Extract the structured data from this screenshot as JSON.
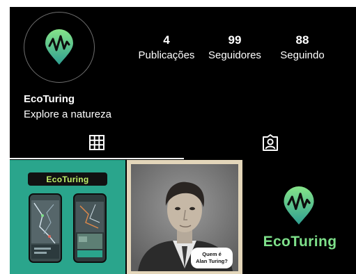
{
  "profile": {
    "name": "EcoTuring",
    "bio": "Explore a natureza"
  },
  "stats": [
    {
      "value": "4",
      "label": "Publicações"
    },
    {
      "value": "99",
      "label": "Seguidores"
    },
    {
      "value": "88",
      "label": "Seguindo"
    }
  ],
  "tabs": [
    {
      "icon": "grid-icon",
      "active": true
    },
    {
      "icon": "tagged-person-icon",
      "active": false
    }
  ],
  "posts": [
    {
      "brand_label": "EcoTuring"
    },
    {
      "bubble_line1": "Quem é",
      "bubble_line2": "Alan Turing?"
    },
    {
      "brand_label": "EcoTuring"
    }
  ],
  "colors": {
    "background": "#000000",
    "logo_gradient_top": "#7ee08a",
    "logo_gradient_bottom": "#2f9f91",
    "post1_background": "#2aa58c",
    "brand_text": "#7ee08a"
  }
}
